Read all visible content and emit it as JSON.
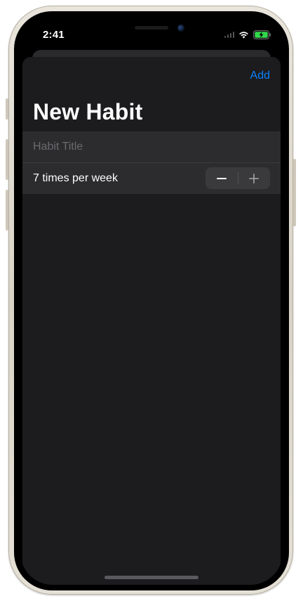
{
  "status_bar": {
    "time": "2:41"
  },
  "sheet": {
    "add_label": "Add",
    "title": "New Habit",
    "title_field": {
      "placeholder": "Habit Title",
      "value": ""
    },
    "frequency": {
      "label": "7 times per week",
      "times_per_week": 7
    }
  },
  "colors": {
    "accent": "#0a84ff",
    "sheet_background": "#1c1c1e",
    "row_background": "#2c2c2e",
    "battery": "#32d74b"
  },
  "icons": [
    "wifi-icon",
    "battery-charging-icon",
    "minus-icon",
    "plus-icon"
  ]
}
